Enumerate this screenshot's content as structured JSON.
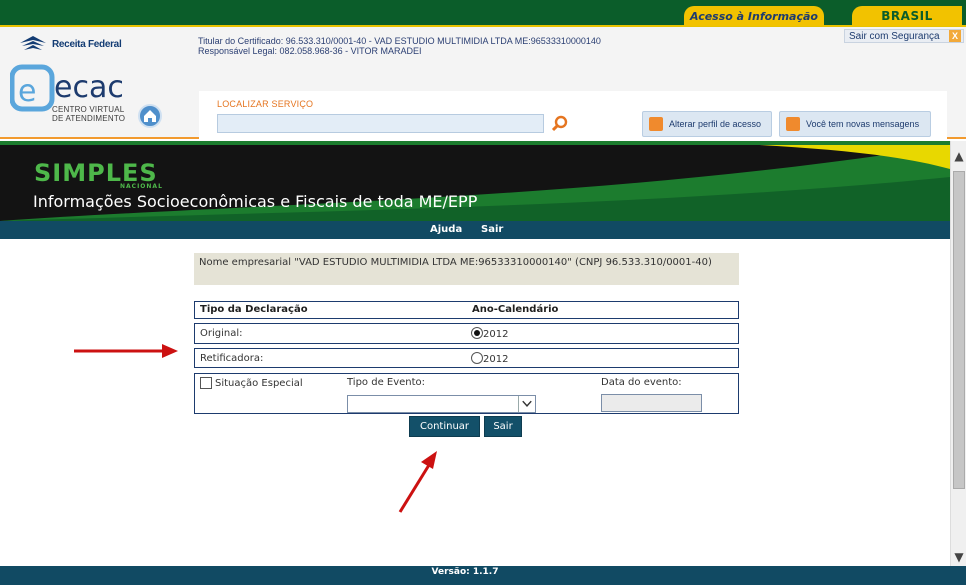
{
  "gov_bar": {
    "acesso": "Acesso à Informação",
    "brasil": "BRASIL"
  },
  "header": {
    "receita": "Receita Federal",
    "cert_titular": "Titular do Certificado: 96.533.310/0001-40 - VAD ESTUDIO MULTIMIDIA LTDA ME:96533310000140",
    "cert_responsavel": "Responsável Legal: 082.058.968-36 - VITOR MARADEI",
    "sair_seguranca": "Sair com Segurança",
    "sair_x": "X",
    "ecac": "ecac",
    "ecac_sub1": "CENTRO VIRTUAL",
    "ecac_sub2": "DE ATENDIMENTO",
    "search_label": "LOCALIZAR SERVIÇO",
    "search_value": "",
    "perfil_btn": "Alterar perfil de acesso",
    "mensagens_btn": "Você tem novas mensagens"
  },
  "banner": {
    "logo": "SIMPLES",
    "logo_sub": "NACIONAL",
    "title": "Informações Socioeconômicas e Fiscais de toda ME/EPP"
  },
  "menu": {
    "ajuda": "Ajuda",
    "sair": "Sair"
  },
  "main": {
    "empresa": "Nome empresarial \"VAD ESTUDIO MULTIMIDIA LTDA ME:96533310000140\" (CNPJ 96.533.310/0001-40)",
    "col_tipo": "Tipo da Declaração",
    "col_ano": "Ano-Calendário",
    "original_label": "Original:",
    "original_year": "2012",
    "original_checked": true,
    "retif_label": "Retificadora:",
    "retif_year": "2012",
    "retif_checked": false,
    "situacao_label": "Situação Especial",
    "situacao_checked": false,
    "evento_label": "Tipo de Evento:",
    "evento_value": "",
    "data_label": "Data do evento:",
    "data_value": "",
    "btn_continuar": "Continuar",
    "btn_sair": "Sair"
  },
  "footer": {
    "versao": "Versão: 1.1.7"
  },
  "colors": {
    "gov_green": "#0b5d2a",
    "gov_yellow": "#f2c200",
    "simples_green": "#4eb84a",
    "menu_blue": "#114a63",
    "annotation_red": "#cc1111",
    "search_orange": "#e57520"
  },
  "icons": [
    "receita-emblem-icon",
    "ecac-logo-icon",
    "home-icon",
    "search-icon",
    "perfil-icon",
    "mail-icon",
    "close-icon",
    "scroll-up-icon",
    "scroll-down-icon",
    "dropdown-arrow-icon"
  ]
}
